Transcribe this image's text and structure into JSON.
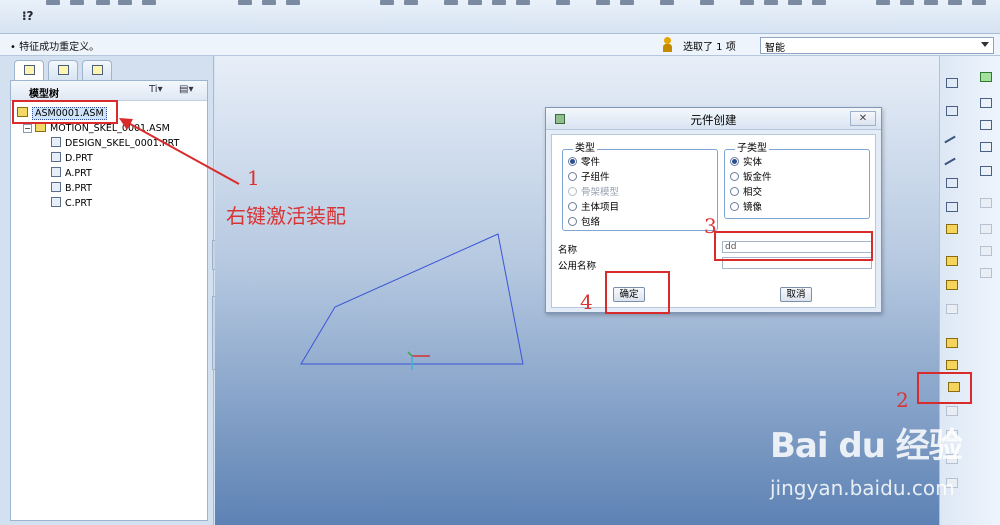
{
  "toolbar": {
    "whats_this": "⁝?"
  },
  "message_bar": {
    "message": "• 特征成功重定义。",
    "selection_count": "选取了 1 项",
    "filter_value": "智能"
  },
  "model_tree": {
    "title": "模型树",
    "settings_label": "Ti▾",
    "show_label": "▤▾",
    "items": [
      {
        "label": "ASM0001.ASM",
        "type": "assembly",
        "level": 0
      },
      {
        "label": "MOTION_SKEL_0001.ASM",
        "type": "assembly",
        "level": 1
      },
      {
        "label": "DESIGN_SKEL_0001.PRT",
        "type": "part",
        "level": 2
      },
      {
        "label": "D.PRT",
        "type": "part",
        "level": 2
      },
      {
        "label": "A.PRT",
        "type": "part",
        "level": 2
      },
      {
        "label": "B.PRT",
        "type": "part",
        "level": 2
      },
      {
        "label": "C.PRT",
        "type": "part",
        "level": 2
      }
    ]
  },
  "dialog": {
    "title": "元件创建",
    "close_label": "✕",
    "type_group": {
      "title": "类型",
      "options": [
        {
          "label": "零件",
          "selected": true,
          "enabled": true
        },
        {
          "label": "子组件",
          "selected": false,
          "enabled": true
        },
        {
          "label": "骨架模型",
          "selected": false,
          "enabled": false
        },
        {
          "label": "主体项目",
          "selected": false,
          "enabled": true
        },
        {
          "label": "包络",
          "selected": false,
          "enabled": true
        }
      ]
    },
    "subtype_group": {
      "title": "子类型",
      "options": [
        {
          "label": "实体",
          "selected": true
        },
        {
          "label": "钣金件",
          "selected": false
        },
        {
          "label": "相交",
          "selected": false
        },
        {
          "label": "镜像",
          "selected": false
        }
      ]
    },
    "name_label": "名称",
    "name_value": "dd",
    "common_name_label": "公用名称",
    "common_name_value": "",
    "ok_label": "确定",
    "cancel_label": "取消"
  },
  "annotations": {
    "step1": "1",
    "step1_note": "右键激活装配",
    "step2": "2",
    "step3": "3",
    "step4": "4",
    "color": "#d92b2b"
  },
  "watermark": {
    "logo": "Bai du 经验",
    "url": "jingyan.baidu.com"
  },
  "colors": {
    "sketch_line": "#3b55d6",
    "graphics_top": "#e7eef8",
    "graphics_bottom": "#5d82b4"
  }
}
